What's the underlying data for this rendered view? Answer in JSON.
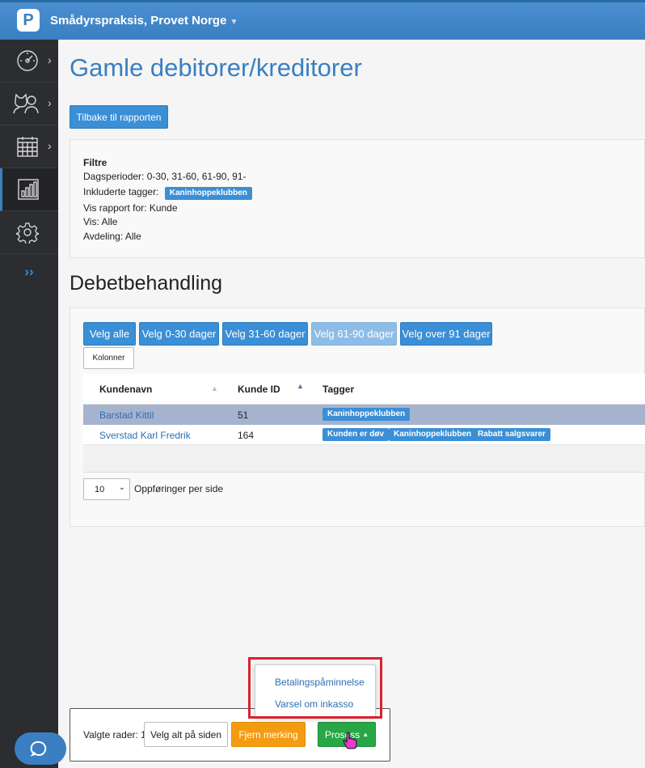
{
  "header": {
    "clinic_name": "Smådyrspraksis, Provet Norge",
    "logo_letter": "P"
  },
  "sidebar": {
    "items": [
      {
        "icon": "dashboard-gauge-icon"
      },
      {
        "icon": "patients-icon"
      },
      {
        "icon": "calendar-icon"
      },
      {
        "icon": "reports-chart-icon"
      },
      {
        "icon": "settings-gear-icon"
      }
    ],
    "expand_label": "››",
    "arrow": "›"
  },
  "page": {
    "title": "Gamle debitorer/kreditorer",
    "back_button": "Tilbake til rapporten"
  },
  "filters": {
    "heading": "Filtre",
    "day_periods": "Dagsperioder: 0-30, 31-60, 61-90, 91-",
    "tags_label": "Inkluderte tagger:",
    "tag": "Kaninhoppeklubben",
    "report_for": "Vis rapport for: Kunde",
    "show": "Vis: Alle",
    "department": "Avdeling: Alle"
  },
  "debt": {
    "title": "Debetbehandling",
    "filter_buttons": [
      "Velg alle",
      "Velg 0-30 dager",
      "Velg 31-60 dager",
      "Velg 61-90 dager",
      "Velg over 91 dager"
    ],
    "columns_button": "Kolonner",
    "table": {
      "headers": [
        "Kundenavn",
        "Kunde ID",
        "Tagger"
      ],
      "rows": [
        {
          "name": "Barstad Kittil",
          "id": "51",
          "tags": [
            "Kaninhoppeklubben"
          ],
          "selected": true
        },
        {
          "name": "Sverstad Karl Fredrik",
          "id": "164",
          "tags": [
            "Kunden er døv",
            "Kaninhoppeklubben",
            "Rabatt salgsvarer"
          ],
          "selected": false
        }
      ]
    },
    "page_size": "10",
    "page_size_label": "Oppføringer per side"
  },
  "actions": {
    "selected_rows": "Valgte rader: 1",
    "select_all_page": "Velg alt på siden",
    "clear_selection": "Fjern merking",
    "process": "Prosess",
    "menu": [
      "Betalingspåminnelse",
      "Varsel om inkasso"
    ]
  },
  "colors": {
    "brand": "#3a7fc1",
    "sidebar": "#2b2d30",
    "highlight": "#d9232d",
    "selected_row": "#a6b3cf"
  }
}
